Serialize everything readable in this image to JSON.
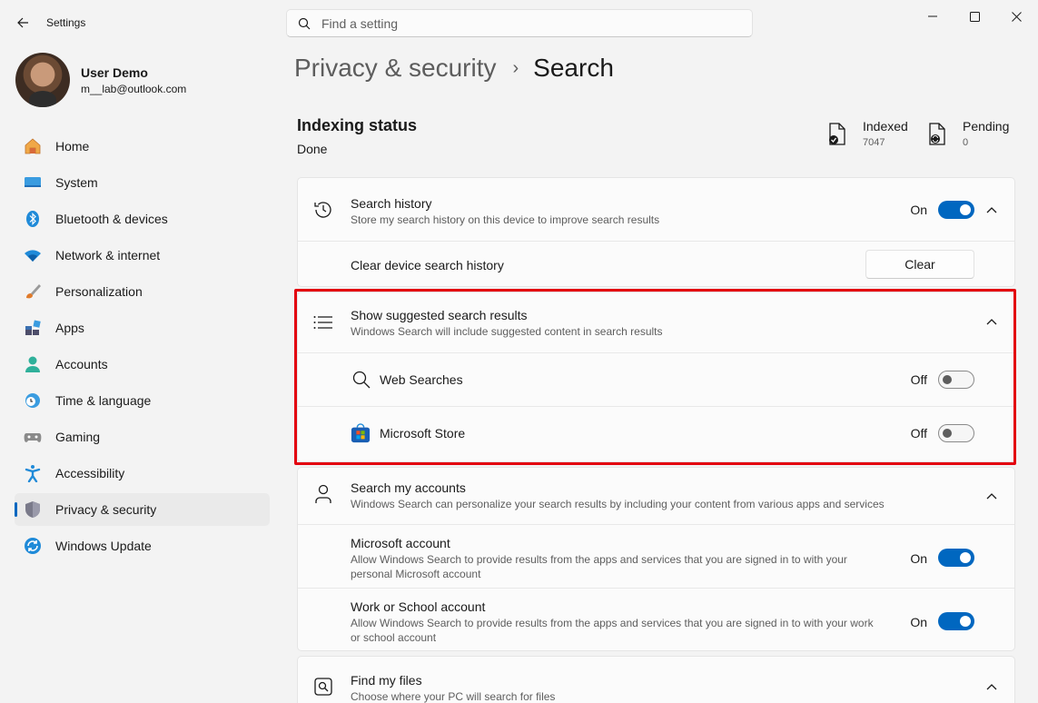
{
  "window": {
    "title": "Settings",
    "search_placeholder": "Find a setting"
  },
  "profile": {
    "name": "User Demo",
    "email": "m__lab@outlook.com"
  },
  "nav": {
    "items": [
      {
        "label": "Home",
        "icon": "home-icon"
      },
      {
        "label": "System",
        "icon": "system-icon"
      },
      {
        "label": "Bluetooth & devices",
        "icon": "bluetooth-icon"
      },
      {
        "label": "Network & internet",
        "icon": "wifi-icon"
      },
      {
        "label": "Personalization",
        "icon": "brush-icon"
      },
      {
        "label": "Apps",
        "icon": "apps-icon"
      },
      {
        "label": "Accounts",
        "icon": "accounts-icon"
      },
      {
        "label": "Time & language",
        "icon": "clock-globe-icon"
      },
      {
        "label": "Gaming",
        "icon": "gamepad-icon"
      },
      {
        "label": "Accessibility",
        "icon": "accessibility-icon"
      },
      {
        "label": "Privacy & security",
        "icon": "shield-icon",
        "active": true
      },
      {
        "label": "Windows Update",
        "icon": "update-icon"
      }
    ]
  },
  "breadcrumb": {
    "parent": "Privacy & security",
    "separator": "›",
    "current": "Search"
  },
  "indexing": {
    "title": "Indexing status",
    "status": "Done",
    "indexed_label": "Indexed",
    "indexed_value": "7047",
    "pending_label": "Pending",
    "pending_value": "0"
  },
  "search_history": {
    "title": "Search history",
    "desc": "Store my search history on this device to improve search results",
    "toggle_label": "On",
    "clear_title": "Clear device search history",
    "clear_button": "Clear"
  },
  "suggested": {
    "title": "Show suggested search results",
    "desc": "Windows Search will include suggested content in search results",
    "web_label": "Web Searches",
    "web_toggle": "Off",
    "store_label": "Microsoft Store",
    "store_toggle": "Off"
  },
  "accounts": {
    "title": "Search my accounts",
    "desc": "Windows Search can personalize your search results by including your content from various apps and services",
    "ms_title": "Microsoft account",
    "ms_desc_1": "Allow Windows Search to provide results from the apps and services that you are signed in to with your",
    "ms_desc_2": "personal Microsoft account",
    "ms_toggle": "On",
    "work_title": "Work or School account",
    "work_desc_1": "Allow Windows Search to provide results from the apps and services that you are signed in to with your work",
    "work_desc_2": "or school account",
    "work_toggle": "On"
  },
  "find_files": {
    "title": "Find my files",
    "desc": "Choose where your PC will search for files"
  },
  "colors": {
    "accent": "#0067c0",
    "highlight": "#e3000f"
  }
}
